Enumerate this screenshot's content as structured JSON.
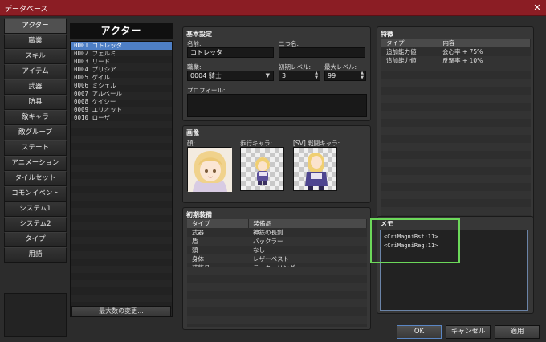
{
  "window": {
    "title": "データベース",
    "close_glyph": "✕"
  },
  "nav": [
    "アクター",
    "職業",
    "スキル",
    "アイテム",
    "武器",
    "防具",
    "敵キャラ",
    "敵グループ",
    "ステート",
    "アニメーション",
    "タイルセット",
    "コモンイベント",
    "システム1",
    "システム2",
    "タイプ",
    "用語"
  ],
  "actor_list": {
    "header": "アクター",
    "rows": [
      "0001 コトレッタ",
      "0002 フェルミ",
      "0003 リード",
      "0004 プリシア",
      "0005 ゲイル",
      "0006 ミシェル",
      "0007 アルベール",
      "0008 ケイシー",
      "0009 エリオット",
      "0010 ローザ"
    ],
    "max_button": "最大数の変更..."
  },
  "basic": {
    "title": "基本設定",
    "name_label": "名前:",
    "name_value": "コトレッタ",
    "nickname_label": "二つ名:",
    "nickname_value": "",
    "class_label": "職業:",
    "class_value": "0004 騎士",
    "init_level_label": "初期レベル:",
    "init_level_value": "3",
    "max_level_label": "最大レベル:",
    "max_level_value": "99",
    "profile_label": "プロフィール:"
  },
  "images": {
    "title": "画像",
    "face_label": "顔:",
    "walk_label": "歩行キャラ:",
    "battle_label": "[SV] 戦闘キャラ:"
  },
  "traits": {
    "title": "特徴",
    "headers": [
      "タイプ",
      "内容"
    ],
    "rows": [
      [
        "追加能力値",
        "会心率 + 75%"
      ],
      [
        "追加能力値",
        "反撃率 + 10%"
      ]
    ]
  },
  "equipment": {
    "title": "初期装備",
    "headers": [
      "タイプ",
      "装備品"
    ],
    "rows": [
      [
        "武器",
        "神鉄の長剣"
      ],
      [
        "盾",
        "バックラー"
      ],
      [
        "頭",
        "なし"
      ],
      [
        "身体",
        "レザーベスト"
      ],
      [
        "装飾品",
        "ラッキーリング"
      ]
    ]
  },
  "memo": {
    "title": "メモ",
    "lines": [
      "<CriMagniBst:11>",
      "<CriMagniReg:11>"
    ]
  },
  "buttons": {
    "ok": "OK",
    "cancel": "キャンセル",
    "apply": "適用"
  },
  "colors": {
    "title_bar": "#8b1d24",
    "selection": "#4e7fc5",
    "highlight": "#6cd85a"
  }
}
